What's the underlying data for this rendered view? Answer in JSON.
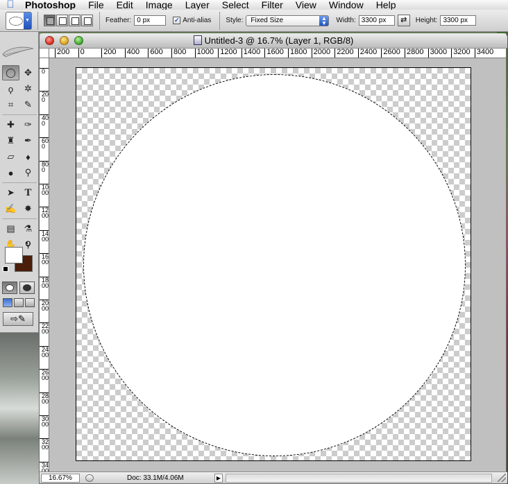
{
  "menubar": {
    "app_name": "Photoshop",
    "items": [
      "File",
      "Edit",
      "Image",
      "Layer",
      "Select",
      "Filter",
      "View",
      "Window",
      "Help"
    ]
  },
  "options": {
    "feather_label": "Feather:",
    "feather_value": "0 px",
    "antialias_label": "Anti-alias",
    "antialias_checked": true,
    "style_label": "Style:",
    "style_value": "Fixed Size",
    "width_label": "Width:",
    "width_value": "3300 px",
    "height_label": "Height:",
    "height_value": "3300 px"
  },
  "document": {
    "title": "Untitled-3 @ 16.7% (Layer 1, RGB/8)",
    "ruler_h_labels": [
      "200",
      "0",
      "200",
      "400",
      "600",
      "800",
      "1000",
      "1200",
      "1400",
      "1600",
      "1800",
      "2000",
      "2200",
      "2400",
      "2600",
      "2800",
      "3000",
      "3200",
      "3400"
    ],
    "ruler_v_labels": [
      "0",
      "200",
      "400",
      "600",
      "800",
      "1000",
      "1200",
      "1400",
      "1600",
      "1800",
      "2000",
      "2200",
      "2400",
      "2600",
      "2800",
      "3000",
      "3200",
      "3400"
    ],
    "zoom": "16.67%",
    "doc_info": "Doc: 33.1M/4.06M"
  },
  "colors": {
    "foreground": "#ffffff",
    "background": "#4a1e0a"
  },
  "icons": {
    "tools": [
      "elliptical-marquee-icon",
      "move-icon",
      "lasso-icon",
      "magic-wand-icon",
      "crop-icon",
      "slice-icon",
      "healing-brush-icon",
      "brush-icon",
      "clone-stamp-icon",
      "history-brush-icon",
      "eraser-icon",
      "paint-bucket-icon",
      "blur-icon",
      "dodge-icon",
      "path-selection-icon",
      "type-icon",
      "pen-icon",
      "custom-shape-icon",
      "notes-icon",
      "eyedropper-icon",
      "hand-icon",
      "zoom-icon"
    ]
  }
}
